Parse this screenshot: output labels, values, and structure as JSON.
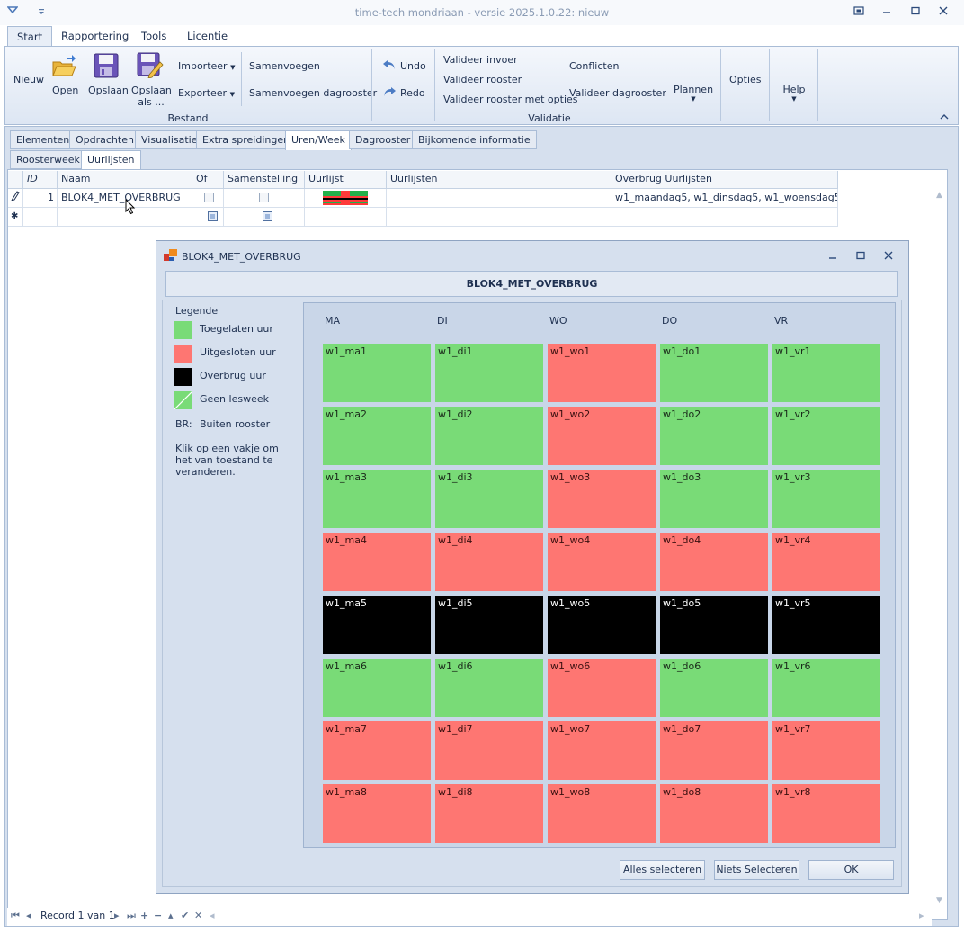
{
  "window": {
    "title": "time-tech mondriaan - versie 2025.1.0.22: nieuw"
  },
  "ribbon": {
    "tabs": [
      "Start",
      "Rapportering",
      "Tools",
      "Licentie"
    ],
    "nieuw": "Nieuw",
    "open": "Open",
    "opslaan": "Opslaan",
    "opslaan_als_1": "Opslaan",
    "opslaan_als_2": "als ...",
    "importeer": "Importeer",
    "exporteer": "Exporteer",
    "samenvoegen": "Samenvoegen",
    "samenvoegen_dagrooster": "Samenvoegen dagrooster",
    "bestand_group": "Bestand",
    "undo": "Undo",
    "redo": "Redo",
    "valideer_invoer": "Valideer invoer",
    "valideer_rooster": "Valideer rooster",
    "valideer_rooster_opties": "Valideer rooster met opties",
    "conflicten": "Conflicten",
    "valideer_dagrooster": "Valideer dagrooster",
    "validatie_group": "Validatie",
    "plannen": "Plannen",
    "opties": "Opties",
    "help": "Help"
  },
  "content_tabs": [
    "Elementen",
    "Opdrachten",
    "Visualisatie",
    "Extra spreidingen",
    "Uren/Week",
    "Dagrooster",
    "Bijkomende informatie"
  ],
  "sub_tabs": [
    "Roosterweek",
    "Uurlijsten"
  ],
  "grid": {
    "headers": [
      "ID",
      "Naam",
      "Of",
      "Samenstelling",
      "Uurlijst",
      "Uurlijsten",
      "Overbrug Uurlijsten"
    ],
    "row": {
      "id": "1",
      "naam": "BLOK4_MET_OVERBRUG",
      "overbrug": "w1_maandag5, w1_dinsdag5, w1_woensdag5, .."
    }
  },
  "navigator": {
    "record_text": "Record 1 van 1"
  },
  "dialog": {
    "title": "BLOK4_MET_OVERBRUG",
    "header": "BLOK4_MET_OVERBRUG",
    "legend": {
      "title": "Legende",
      "toegelaten": "Toegelaten uur",
      "uitgesloten": "Uitgesloten uur",
      "overbrug": "Overbrug uur",
      "geen_lesweek": "Geen lesweek",
      "br_key": "BR:",
      "br_value": "Buiten rooster",
      "hint_1": "Klik op een vakje om",
      "hint_2": "het van toestand te",
      "hint_3": "veranderen."
    },
    "colors": {
      "toegelaten": "#79db77",
      "uitgesloten": "#fe7672",
      "overbrug": "#000000"
    },
    "days": [
      "MA",
      "DI",
      "WO",
      "DO",
      "VR"
    ],
    "cells": [
      [
        {
          "label": "w1_ma1",
          "state": "g"
        },
        {
          "label": "w1_di1",
          "state": "g"
        },
        {
          "label": "w1_wo1",
          "state": "r"
        },
        {
          "label": "w1_do1",
          "state": "g"
        },
        {
          "label": "w1_vr1",
          "state": "g"
        }
      ],
      [
        {
          "label": "w1_ma2",
          "state": "g"
        },
        {
          "label": "w1_di2",
          "state": "g"
        },
        {
          "label": "w1_wo2",
          "state": "r"
        },
        {
          "label": "w1_do2",
          "state": "g"
        },
        {
          "label": "w1_vr2",
          "state": "g"
        }
      ],
      [
        {
          "label": "w1_ma3",
          "state": "g"
        },
        {
          "label": "w1_di3",
          "state": "g"
        },
        {
          "label": "w1_wo3",
          "state": "r"
        },
        {
          "label": "w1_do3",
          "state": "g"
        },
        {
          "label": "w1_vr3",
          "state": "g"
        }
      ],
      [
        {
          "label": "w1_ma4",
          "state": "r"
        },
        {
          "label": "w1_di4",
          "state": "r"
        },
        {
          "label": "w1_wo4",
          "state": "r"
        },
        {
          "label": "w1_do4",
          "state": "r"
        },
        {
          "label": "w1_vr4",
          "state": "r"
        }
      ],
      [
        {
          "label": "w1_ma5",
          "state": "b"
        },
        {
          "label": "w1_di5",
          "state": "b"
        },
        {
          "label": "w1_wo5",
          "state": "b"
        },
        {
          "label": "w1_do5",
          "state": "b"
        },
        {
          "label": "w1_vr5",
          "state": "b"
        }
      ],
      [
        {
          "label": "w1_ma6",
          "state": "g"
        },
        {
          "label": "w1_di6",
          "state": "g"
        },
        {
          "label": "w1_wo6",
          "state": "r"
        },
        {
          "label": "w1_do6",
          "state": "g"
        },
        {
          "label": "w1_vr6",
          "state": "g"
        }
      ],
      [
        {
          "label": "w1_ma7",
          "state": "r"
        },
        {
          "label": "w1_di7",
          "state": "r"
        },
        {
          "label": "w1_wo7",
          "state": "r"
        },
        {
          "label": "w1_do7",
          "state": "r"
        },
        {
          "label": "w1_vr7",
          "state": "r"
        }
      ],
      [
        {
          "label": "w1_ma8",
          "state": "r"
        },
        {
          "label": "w1_di8",
          "state": "r"
        },
        {
          "label": "w1_wo8",
          "state": "r"
        },
        {
          "label": "w1_do8",
          "state": "r"
        },
        {
          "label": "w1_vr8",
          "state": "r"
        }
      ]
    ],
    "buttons": {
      "alles": "Alles selecteren",
      "niets": "Niets Selecteren",
      "ok": "OK"
    }
  }
}
